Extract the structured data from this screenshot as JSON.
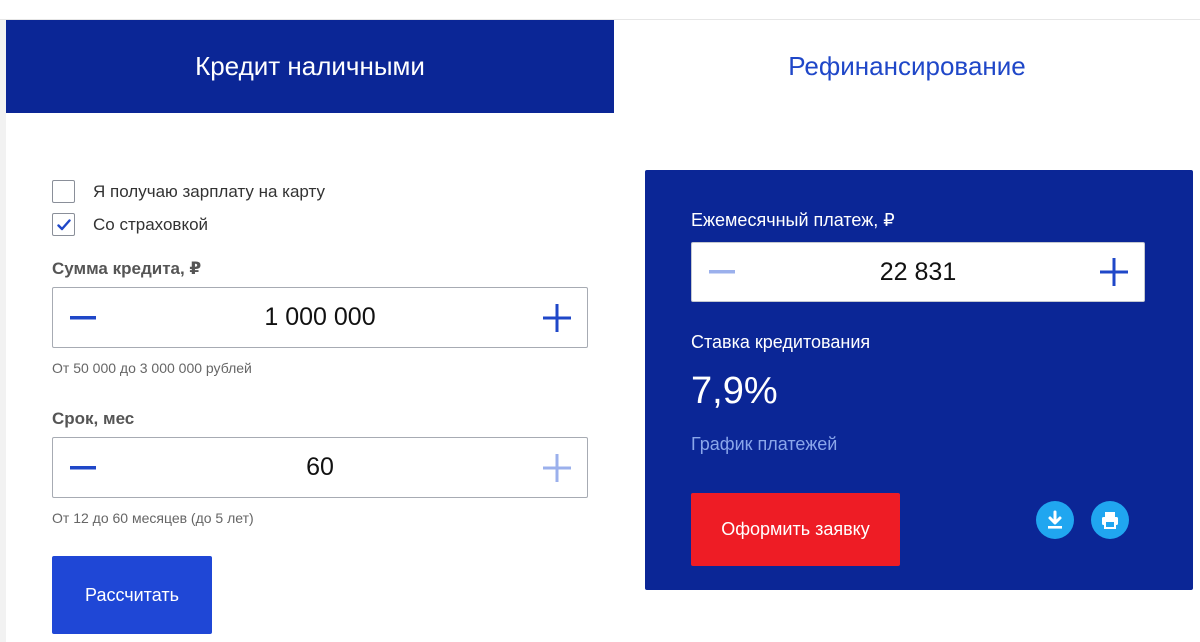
{
  "tabs": {
    "cash_loan": "Кредит наличными",
    "refinancing": "Рефинансирование"
  },
  "options": {
    "salary_card": {
      "label": "Я получаю зарплату на карту",
      "checked": false
    },
    "insurance": {
      "label": "Со страховкой",
      "checked": true
    }
  },
  "loan_amount": {
    "label": "Сумма кредита, ₽",
    "value": "1 000 000",
    "hint": "От 50 000 до 3 000 000 рублей"
  },
  "term": {
    "label": "Срок, мес",
    "value": "60",
    "hint": "От 12 до 60 месяцев (до 5 лет)"
  },
  "calculate_label": "Рассчитать",
  "result": {
    "monthly_payment_label": "Ежемесячный платеж, ₽",
    "monthly_payment_value": "22 831",
    "rate_label": "Ставка кредитования",
    "rate_value": "7,9%",
    "schedule_link": "График платежей",
    "apply_label": "Оформить заявку"
  },
  "icons": {
    "download": "download-icon",
    "print": "print-icon"
  },
  "colors": {
    "brand_blue": "#0b2696",
    "accent_blue": "#1f47d6",
    "apply_red": "#ee1c25",
    "icon_button": "#20a6f0",
    "link_light": "#8aa6ea"
  }
}
